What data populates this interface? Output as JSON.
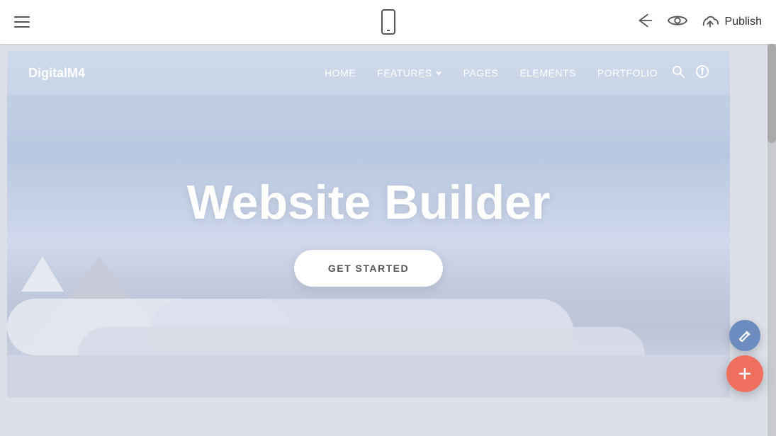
{
  "toolbar": {
    "hamburger_label": "menu",
    "back_label": "back",
    "preview_label": "preview",
    "publish_label": "Publish",
    "mobile_view_label": "mobile view"
  },
  "site": {
    "logo": "DigitalM4",
    "nav": {
      "items": [
        {
          "label": "HOME",
          "has_dropdown": false
        },
        {
          "label": "FEATURES",
          "has_dropdown": true
        },
        {
          "label": "PAGES",
          "has_dropdown": false
        },
        {
          "label": "ELEMENTS",
          "has_dropdown": false
        },
        {
          "label": "PORTFOLIO",
          "has_dropdown": false
        }
      ]
    },
    "hero": {
      "title": "Website Builder",
      "cta_label": "GET STARTED"
    }
  },
  "fab": {
    "edit_label": "edit",
    "add_label": "add"
  }
}
